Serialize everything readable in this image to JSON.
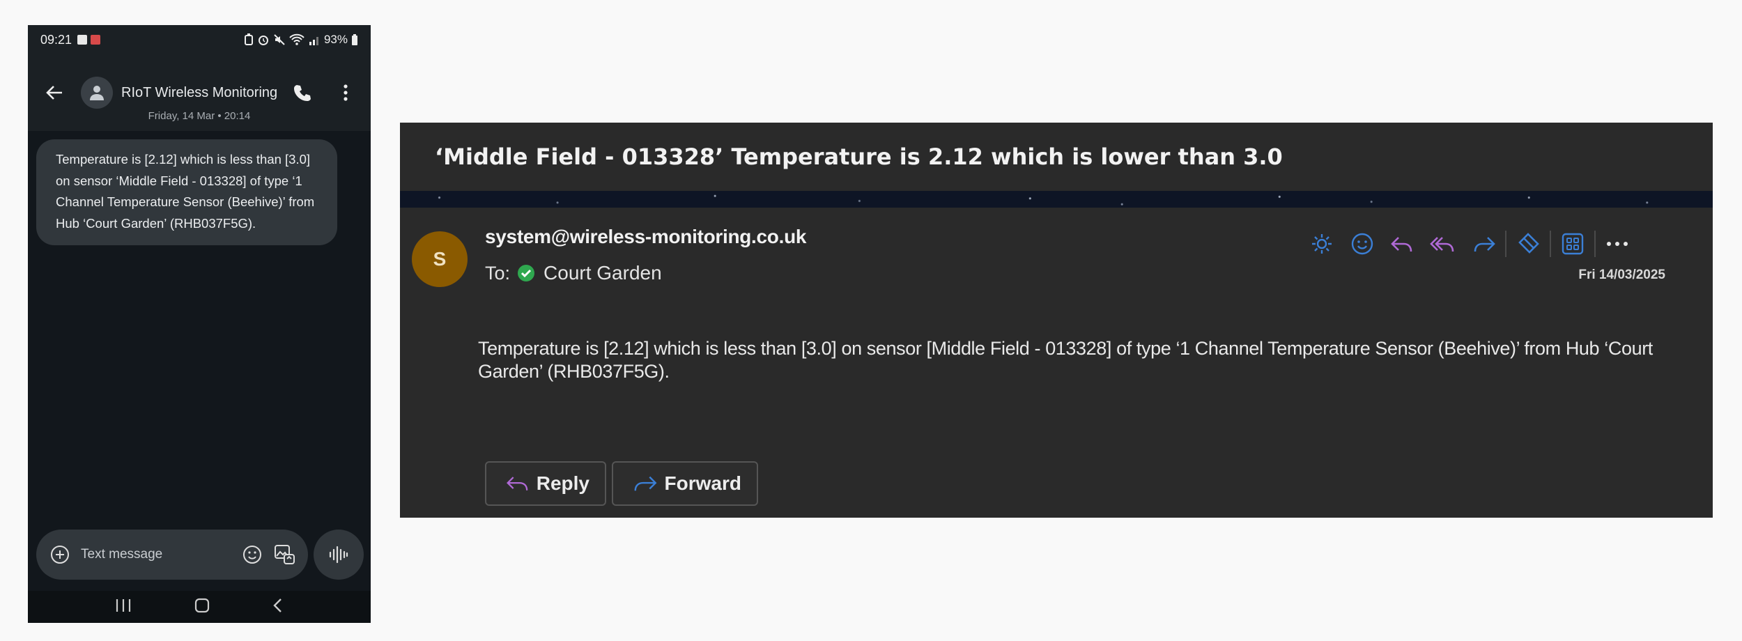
{
  "phone": {
    "status": {
      "time": "09:21",
      "battery": "93%"
    },
    "header": {
      "contact_name": "RIoT Wireless Monitoring"
    },
    "date_separator": "Friday, 14 Mar • 20:14",
    "message": "Temperature is [2.12] which is less than [3.0] on sensor ‘Middle Field - 013328] of type ‘1 Channel Temperature Sensor (Beehive)’ from Hub ‘Court Garden’ (RHB037F5G).",
    "composer": {
      "placeholder": "Text message"
    }
  },
  "email": {
    "subject": "‘Middle Field - 013328’ Temperature is 2.12 which is lower than 3.0",
    "sender_initial": "S",
    "sender": "system@wireless-monitoring.co.uk",
    "to_label": "To:",
    "recipient": "Court Garden",
    "date": "Fri 14/03/2025",
    "body": "Temperature is [2.12] which is less than [3.0] on sensor [Middle Field - 013328] of type ‘1 Channel Temperature Sensor (Beehive)’ from Hub ‘Court Garden’ (RHB037F5G).",
    "reply_label": "Reply",
    "forward_label": "Forward"
  },
  "colors": {
    "avatar": "#8a5a00",
    "toolbar_blue": "#3b7fd6",
    "reply_purple": "#b06ad6",
    "ok_green": "#2fa84f"
  }
}
